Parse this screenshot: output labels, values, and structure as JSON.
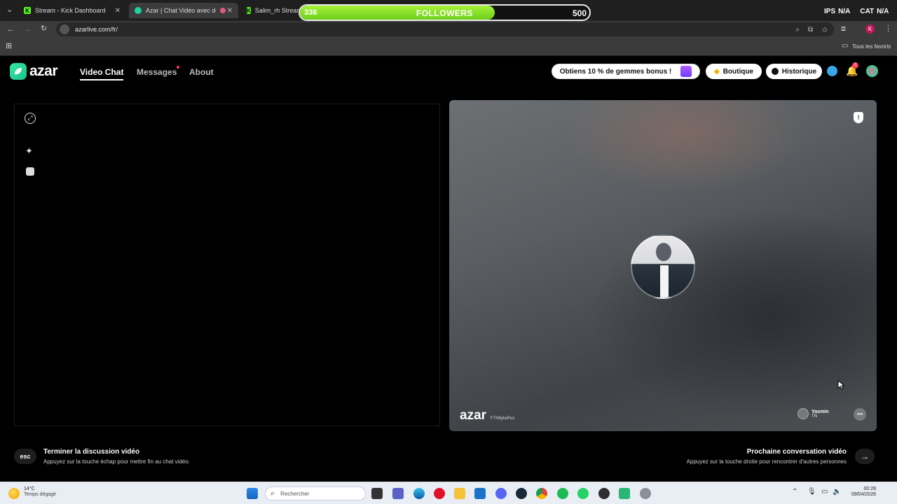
{
  "browser": {
    "tabs": [
      {
        "title": "Stream - Kick Dashboard",
        "active": false
      },
      {
        "title": "Azar | Chat Vidéo avec de n",
        "active": true
      },
      {
        "title": "Salim_rh Stream",
        "active": false
      }
    ],
    "url": "azarlive.com/fr/",
    "all_bookmarks_label": "Tous les favoris",
    "top_right": [
      "IPS",
      "N/A",
      "CAT",
      "N/A"
    ]
  },
  "followers_widget": {
    "current": "336",
    "label": "FOLLOWERS",
    "goal": "500",
    "progress": 0.672
  },
  "azar": {
    "logo_text": "azar",
    "nav": {
      "video_chat": "Video Chat",
      "messages": "Messages",
      "about": "About"
    },
    "promo_label": "Obtiens 10 % de gemmes bonus !",
    "shop_label": "Boutique",
    "history_label": "Historique",
    "notification_badge": "2",
    "remote": {
      "watermark": "azar",
      "watermark_sub": "F7X8ybuPus",
      "user_name": "Yasmin",
      "user_country": "TN"
    },
    "end_chat": {
      "key": "esc",
      "title": "Terminer la discussion vidéo",
      "subtitle": "Appuyez sur la touche échap pour mettre fin au chat vidéo."
    },
    "next_chat": {
      "title": "Prochaine conversation vidéo",
      "subtitle": "Appuyez sur la touche droite pour rencontrer d'autres personnes"
    }
  },
  "taskbar": {
    "weather_temp": "14°C",
    "weather_text": "Temps dégagé",
    "search_placeholder": "Rechercher",
    "time": "00:28",
    "date": "09/04/2026"
  }
}
